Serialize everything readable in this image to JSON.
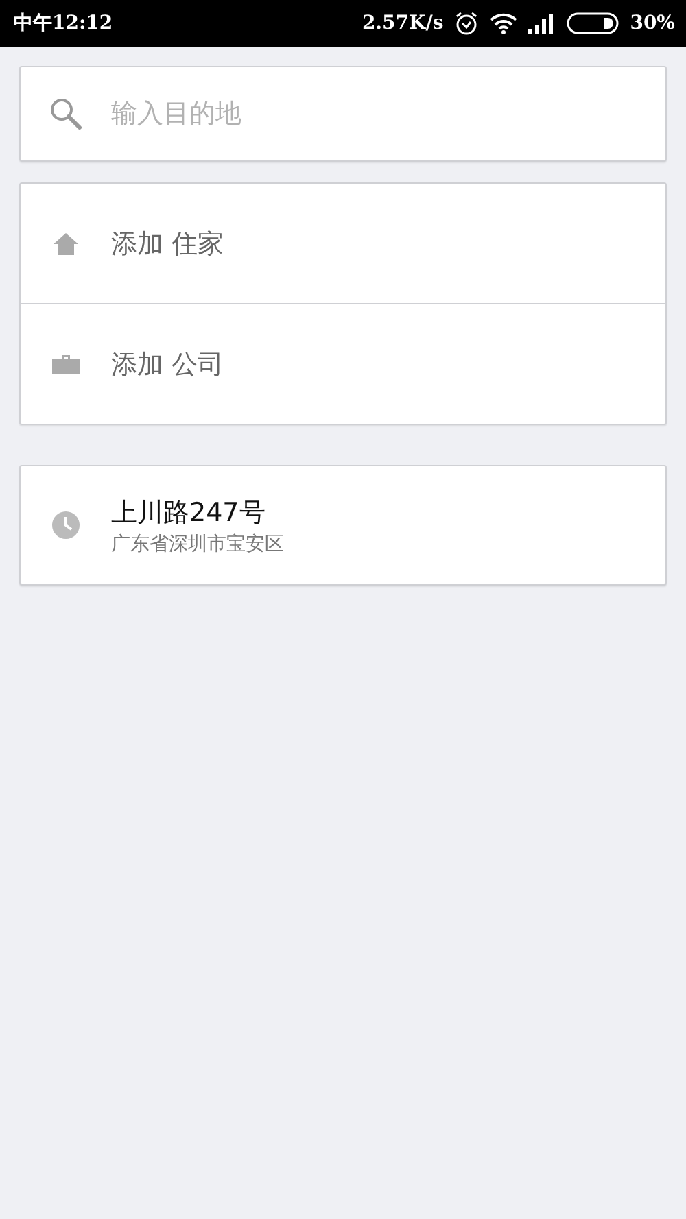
{
  "status_bar": {
    "time": "中午12:12",
    "speed": "2.57K/s",
    "battery": "30%"
  },
  "search": {
    "placeholder": "输入目的地"
  },
  "shortcuts": [
    {
      "kind": "home",
      "label": "添加 住家"
    },
    {
      "kind": "work",
      "label": "添加 公司"
    }
  ],
  "recent": [
    {
      "title": "上川路247号",
      "subtitle": "广东省深圳市宝安区"
    }
  ]
}
